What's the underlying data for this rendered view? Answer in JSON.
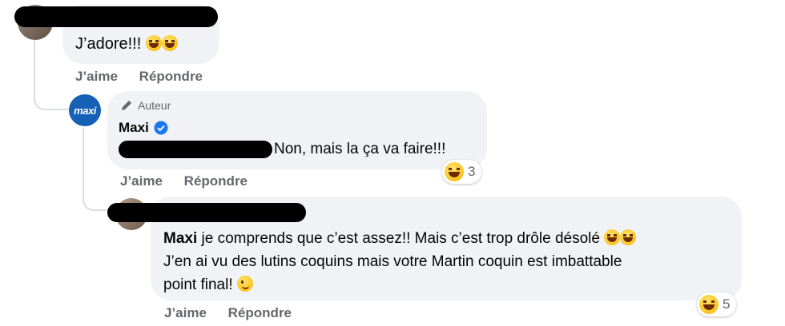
{
  "comment1": {
    "text": "J’adore!!!",
    "actions": {
      "like": "J’aime",
      "reply": "Répondre"
    }
  },
  "comment2": {
    "author_badge": "Auteur",
    "author_name": "Maxi",
    "avatar_text": "maxi",
    "text": "Non, mais la ça va faire!!!",
    "reaction_count": "3",
    "actions": {
      "like": "J’aime",
      "reply": "Répondre"
    }
  },
  "comment3": {
    "mention": "Maxi",
    "text_line1": " je comprends que c’est assez!! Mais c’est trop drôle désolé ",
    "text_line2": "J’en ai vu des lutins coquins mais votre Martin coquin est imbattable",
    "text_line3": "point final! ",
    "reaction_count": "5",
    "actions": {
      "like": "J’aime",
      "reply": "Répondre"
    }
  },
  "colors": {
    "bubble": "#f0f2f5",
    "verified": "#1877f2",
    "maxi_brand": "#1660b5",
    "action_text": "#65676b"
  },
  "icons": [
    "pencil-icon",
    "verified-badge-icon",
    "laughing-emoji",
    "wink-emoji"
  ]
}
